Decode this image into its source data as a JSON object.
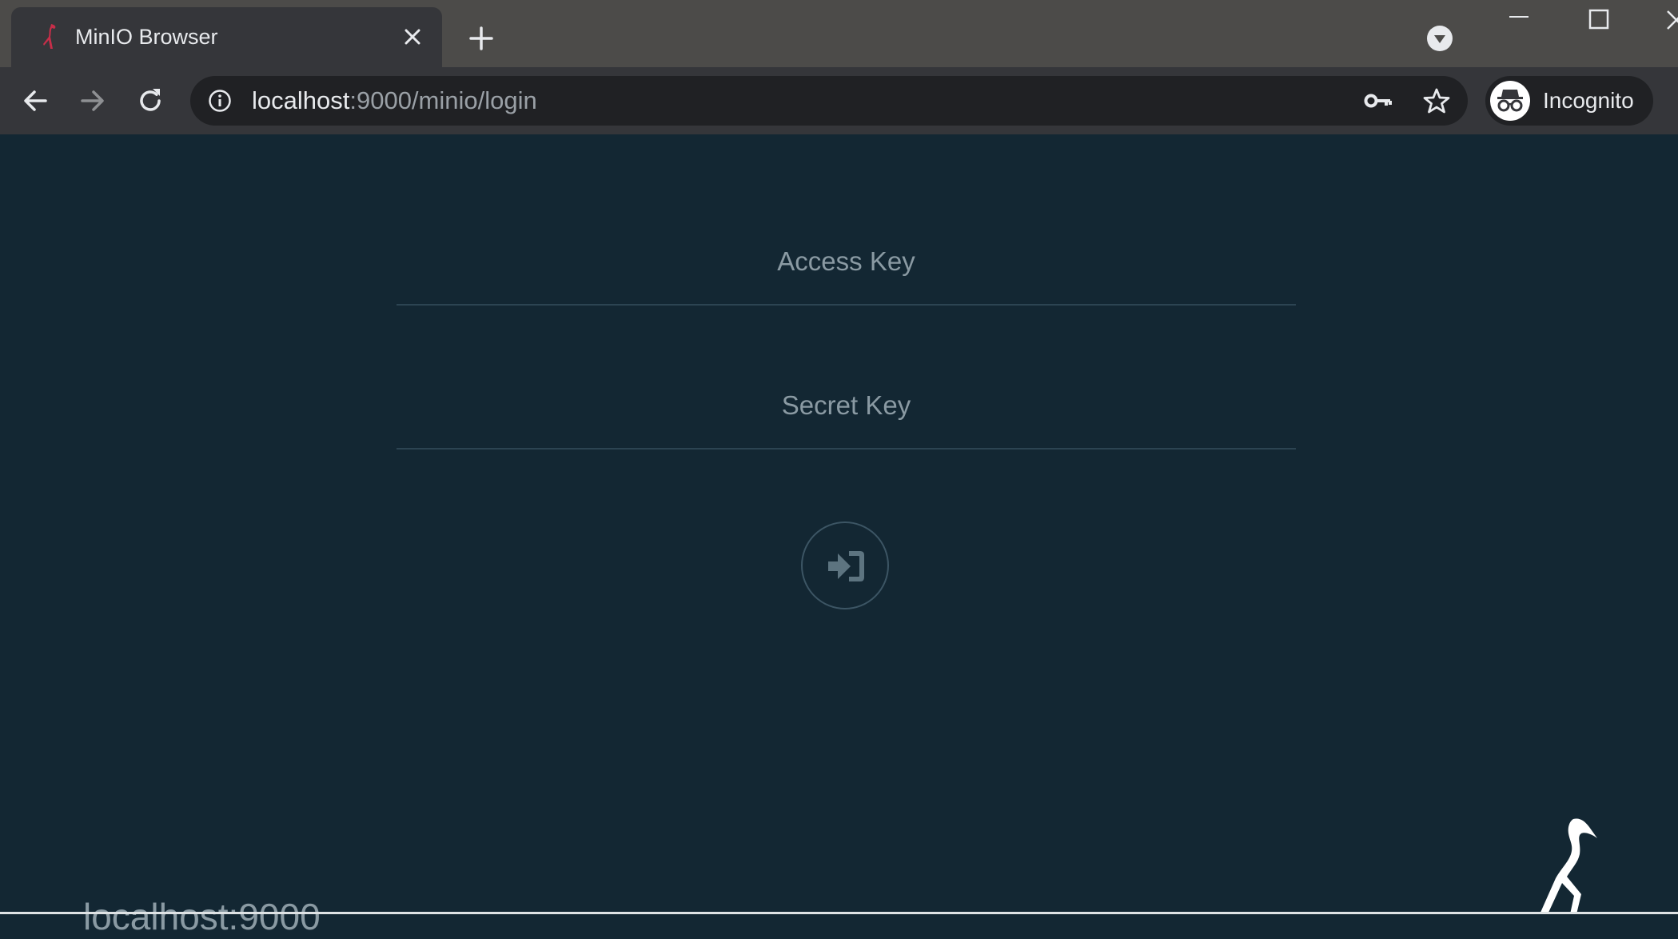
{
  "browser": {
    "tab": {
      "title": "MinIO Browser"
    },
    "address_bar": {
      "host": "localhost",
      "rest": ":9000/minio/login"
    },
    "profile": {
      "label": "Incognito"
    }
  },
  "login": {
    "access_key_placeholder": "Access Key",
    "secret_key_placeholder": "Secret Key"
  },
  "footer": {
    "host": "localhost:9000"
  },
  "colors": {
    "page_background": "#132733",
    "tab_strip": "#4c4b49",
    "toolbar": "#35363a",
    "omnibox": "#202124",
    "placeholder": "#8a9aa3",
    "brand_red": "#c72e49"
  },
  "icons": {
    "favicon": "minio-bird-icon",
    "tab_close": "close-icon",
    "new_tab": "plus-icon",
    "tab_search": "chevron-down-icon",
    "back": "arrow-left-icon",
    "forward": "arrow-right-icon",
    "reload": "reload-icon",
    "site_info": "info-icon",
    "password": "key-icon",
    "bookmark": "star-icon",
    "incognito": "incognito-icon",
    "login": "sign-in-icon",
    "logo": "minio-logo-icon"
  }
}
